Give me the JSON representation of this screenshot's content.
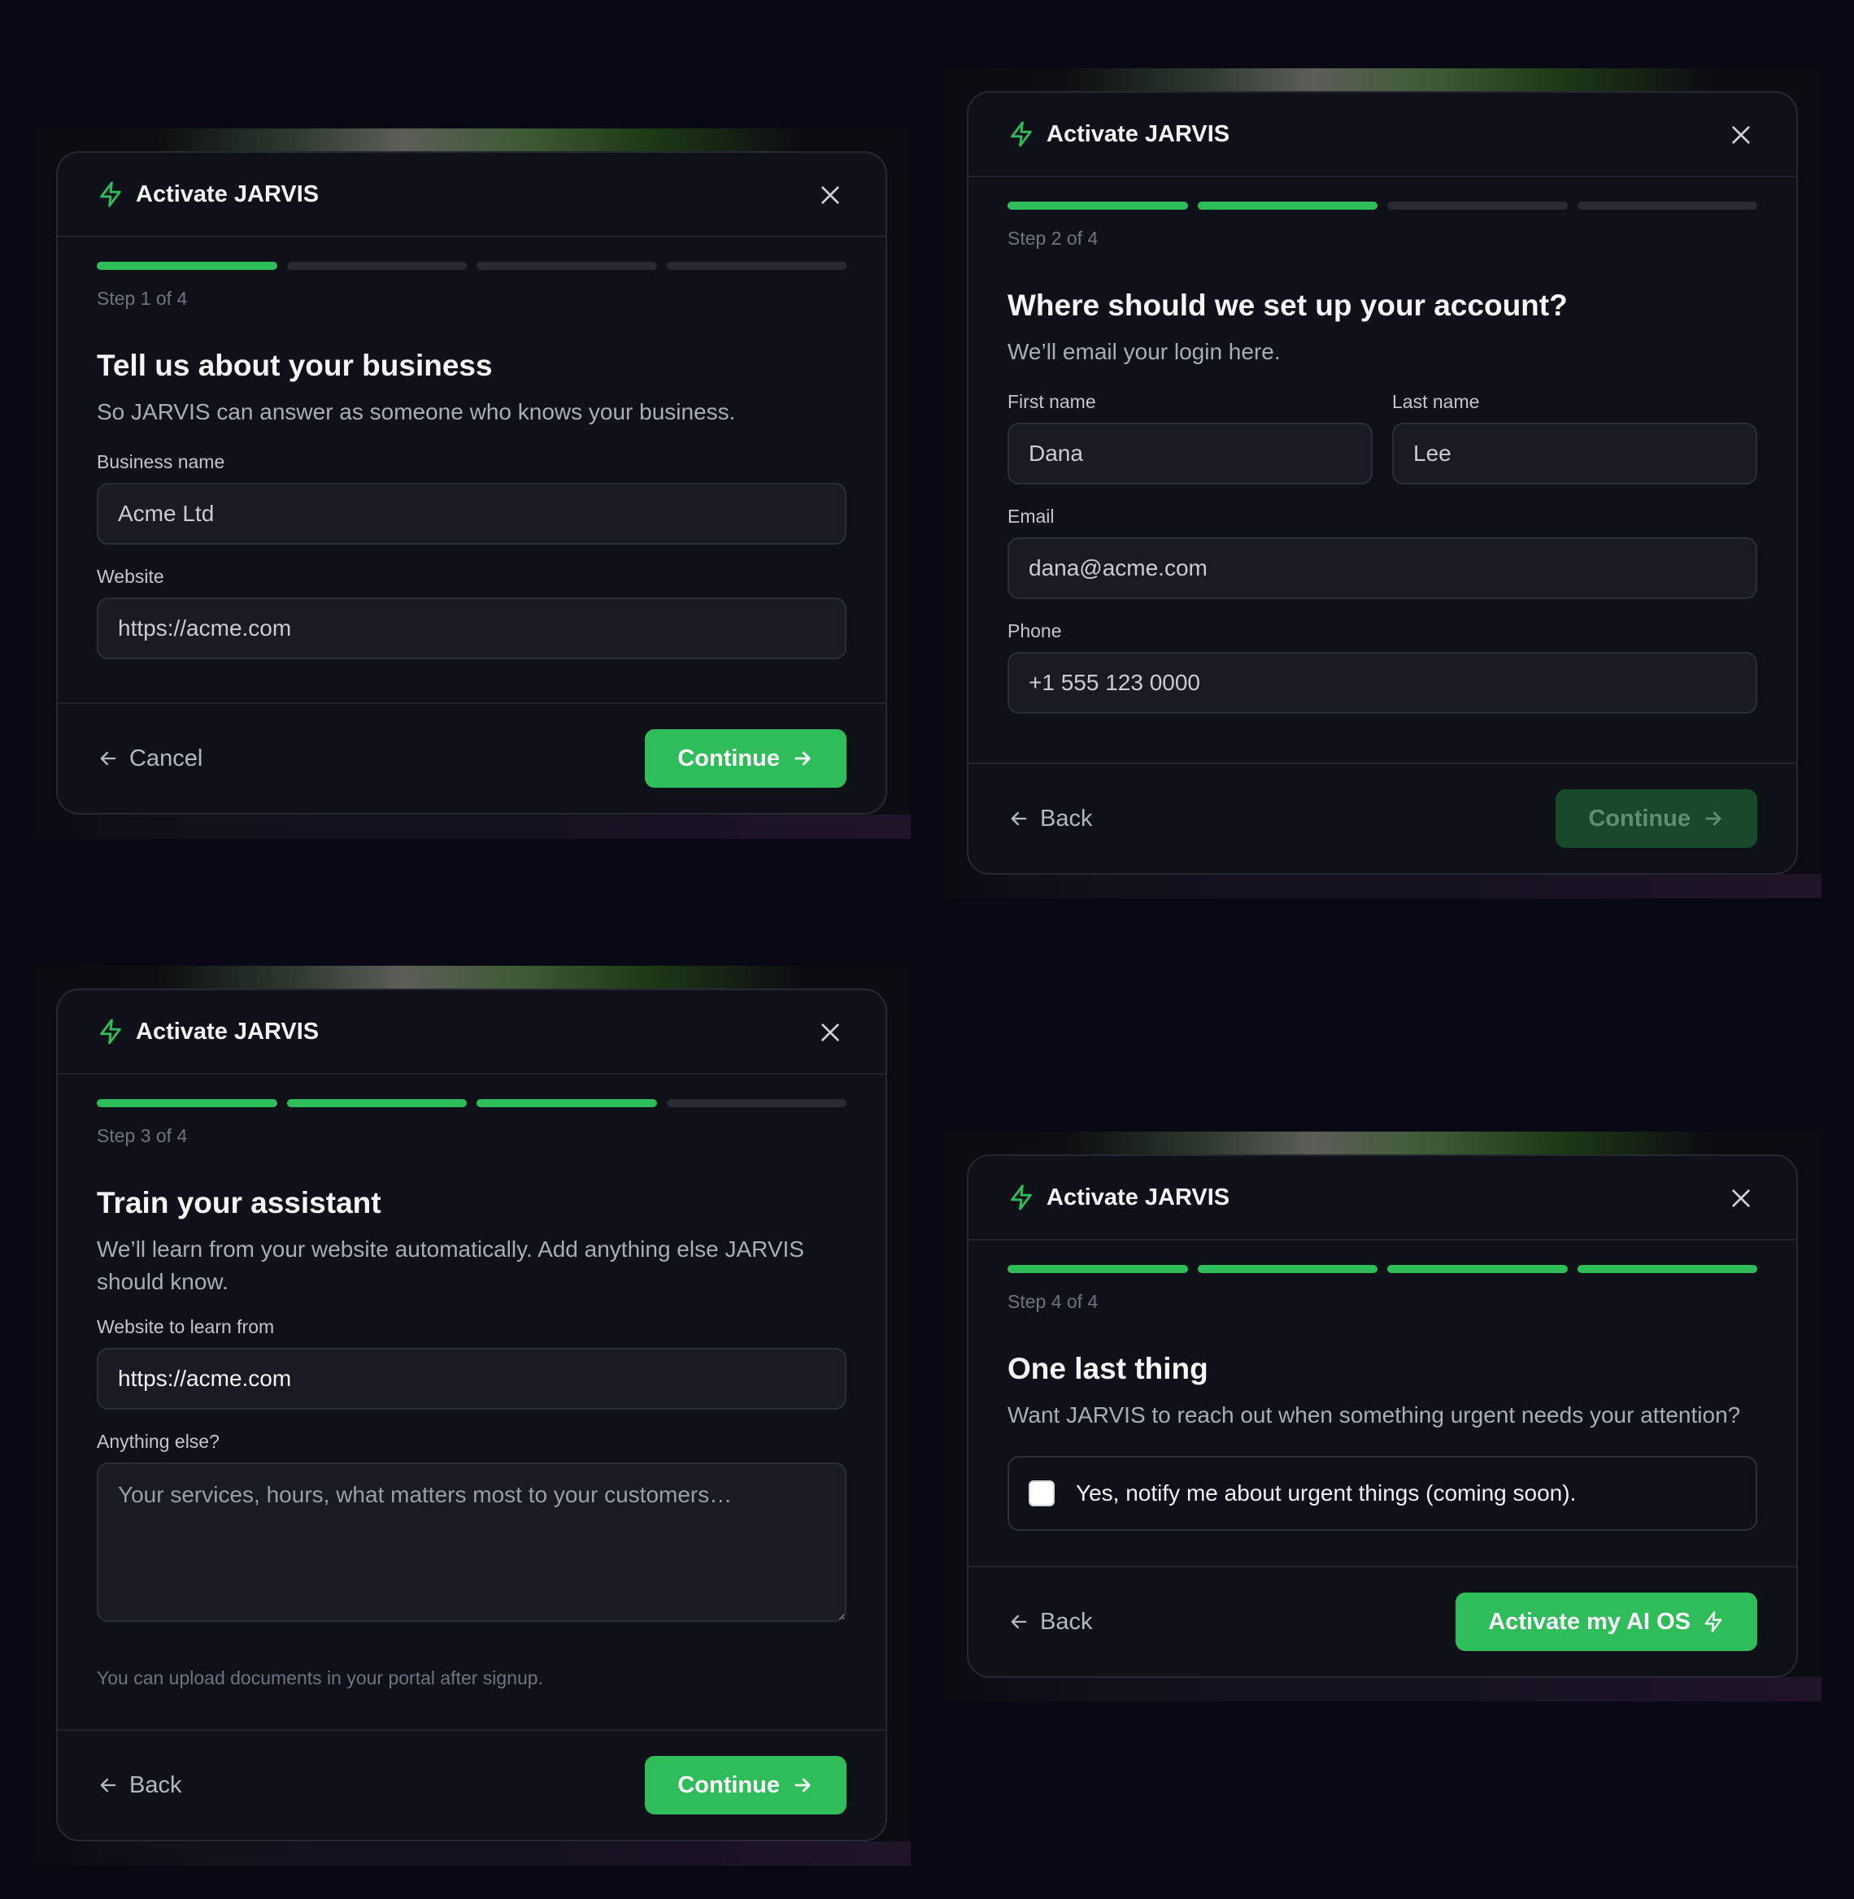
{
  "colors": {
    "accent": "#2fbd5a",
    "accent_disabled": "#164a2a",
    "background": "#080914",
    "card": "#0f1119"
  },
  "icons": {
    "title": "bolt-icon",
    "close": "close-icon",
    "back": "arrow-left-icon",
    "next": "arrow-right-icon"
  },
  "panel1": {
    "title": "Activate JARVIS",
    "progress_filled": 1,
    "progress_total": 4,
    "step": "Step 1 of 4",
    "heading": "Tell us about your business",
    "subtitle": "So JARVIS can answer as someone who knows your business.",
    "business_name_label": "Business name",
    "business_name_value": "Acme Ltd",
    "website_label": "Website",
    "website_value": "https://acme.com",
    "cancel": "Cancel",
    "continue": "Continue"
  },
  "panel2": {
    "title": "Activate JARVIS",
    "progress_filled": 2,
    "progress_total": 4,
    "step": "Step 2 of 4",
    "heading": "Where should we set up your account?",
    "subtitle": "We’ll email your login here.",
    "first_name_label": "First name",
    "first_name_value": "Dana",
    "last_name_label": "Last name",
    "last_name_value": "Lee",
    "email_label": "Email",
    "email_value": "dana@acme.com",
    "phone_label": "Phone",
    "phone_value": "+1 555 123 0000",
    "back": "Back",
    "continue": "Continue"
  },
  "panel3": {
    "title": "Activate JARVIS",
    "progress_filled": 3,
    "progress_total": 4,
    "step": "Step 3 of 4",
    "heading": "Train your assistant",
    "subtitle": "We’ll learn from your website automatically. Add anything else JARVIS should know.",
    "website_label": "Website to learn from",
    "website_value": "https://acme.com",
    "anything_label": "Anything else?",
    "anything_placeholder": "Your services, hours, what matters most to your customers…",
    "hint": "You can upload documents in your portal after signup.",
    "back": "Back",
    "continue": "Continue"
  },
  "panel4": {
    "title": "Activate JARVIS",
    "progress_filled": 4,
    "progress_total": 4,
    "step": "Step 4 of 4",
    "heading": "One last thing",
    "subtitle": "Want JARVIS to reach out when something urgent needs your attention?",
    "notify_label": "Yes, notify me about urgent things (coming soon).",
    "back": "Back",
    "activate": "Activate my AI OS"
  }
}
